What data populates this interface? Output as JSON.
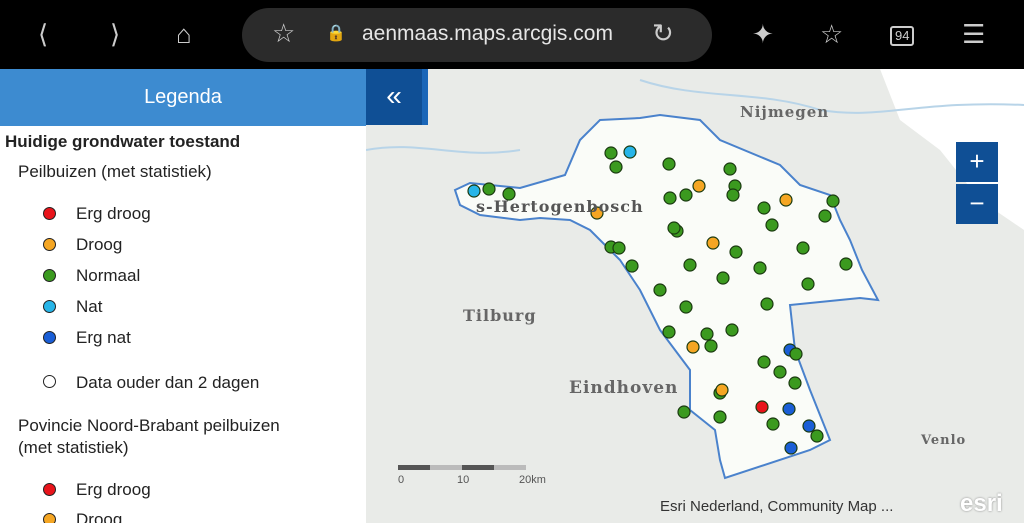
{
  "browser": {
    "url": "aenmaas.maps.arcgis.com",
    "tabs_count": "94"
  },
  "legend": {
    "title": "Legenda",
    "section": "Huidige grondwater toestand",
    "group1": "Peilbuizen (met statistiek)",
    "items": [
      {
        "label": "Erg droog",
        "color": "#e8141b"
      },
      {
        "label": "Droog",
        "color": "#f5a623"
      },
      {
        "label": "Normaal",
        "color": "#3b9a1f"
      },
      {
        "label": "Nat",
        "color": "#27b5e8"
      },
      {
        "label": "Erg nat",
        "color": "#1a5ed6"
      }
    ],
    "old_data": "Data ouder dan 2 dagen",
    "group2_line1": "Povincie Noord-Brabant peilbuizen",
    "group2_line2": "(met statistiek)",
    "items2": [
      {
        "label": "Erg droog",
        "color": "#e8141b"
      },
      {
        "label": "Droog",
        "color": "#f5a623"
      }
    ]
  },
  "map": {
    "cities": [
      "Nijmegen",
      "s-Hertogenbosch",
      "Tilburg",
      "Eindhoven",
      "Venlo"
    ],
    "zoom_in": "+",
    "zoom_out": "−",
    "scale": [
      "0",
      "10",
      "20km"
    ],
    "attribution": "Esri Nederland, Community Map ...",
    "logo": "esri"
  }
}
